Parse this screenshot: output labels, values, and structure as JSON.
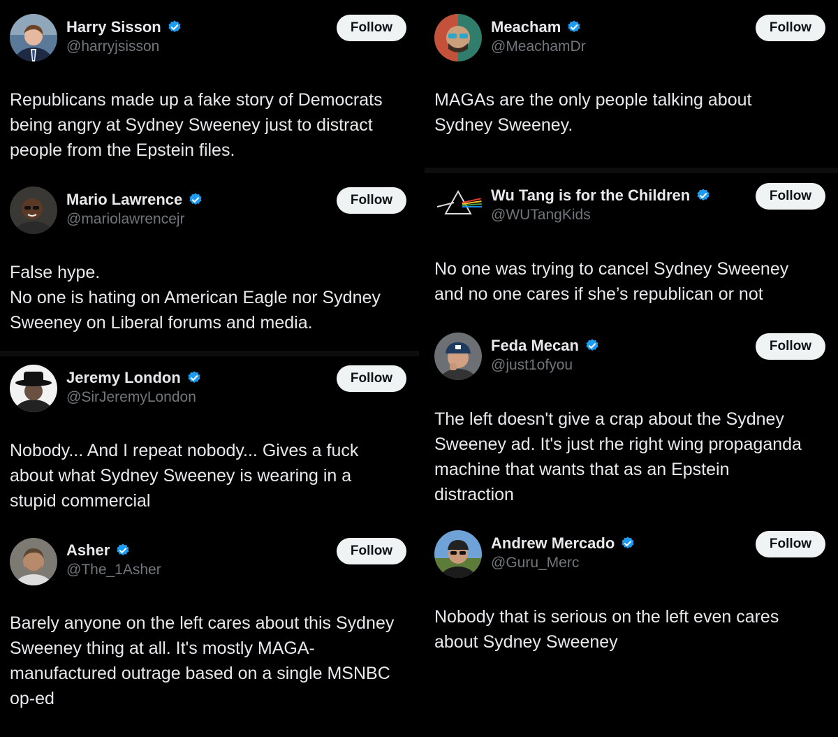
{
  "colors": {
    "background": "#000000",
    "text": "#e7e9ea",
    "handle": "#71767b",
    "verified_badge": "#1d9bf0",
    "follow_button_bg": "#eff3f4",
    "follow_button_text": "#0f1419"
  },
  "icons": {
    "verified": "verified-badge-icon"
  },
  "tweets": [
    {
      "name": "Harry Sisson",
      "handle": "@harryjsisson",
      "follow_label": "Follow",
      "text_lines": [
        "Republicans made up a fake story of Democrats",
        "being angry at Sydney Sweeney just to distract",
        "people from the Epstein files."
      ]
    },
    {
      "name": "Mario Lawrence",
      "handle": "@mariolawrencejr",
      "follow_label": "Follow",
      "text_lines": [
        "False hype.",
        "No one is hating on American Eagle nor Sydney",
        "Sweeney on Liberal forums and media."
      ]
    },
    {
      "name": "Jeremy London",
      "handle": "@SirJeremyLondon",
      "follow_label": "Follow",
      "text_lines": [
        "Nobody... And I repeat nobody... Gives a fuck",
        "about what Sydney Sweeney is wearing in a",
        "stupid commercial"
      ]
    },
    {
      "name": "Asher",
      "handle": "@The_1Asher",
      "follow_label": "Follow",
      "text_lines": [
        "Barely anyone on the left cares about this Sydney",
        "Sweeney thing at all. It's mostly MAGA-",
        "manufactured outrage based on a single MSNBC",
        "op-ed"
      ]
    },
    {
      "name": "Meacham",
      "handle": "@MeachamDr",
      "follow_label": "Follow",
      "text_lines": [
        "MAGAs are the only people talking about",
        "Sydney Sweeney."
      ]
    },
    {
      "name": "Wu Tang is for the Children",
      "handle": "@WUTangKids",
      "follow_label": "Follow",
      "text_lines": [
        "No one was trying to cancel Sydney Sweeney",
        "and no one cares if she’s republican or not"
      ]
    },
    {
      "name": "Feda Mecan",
      "handle": "@just1ofyou",
      "follow_label": "Follow",
      "text_lines": [
        "The left doesn't give a crap about the Sydney",
        "Sweeney ad. It's just rhe right wing propaganda",
        "machine that wants that as an Epstein",
        "distraction"
      ]
    },
    {
      "name": "Andrew Mercado",
      "handle": "@Guru_Merc",
      "follow_label": "Follow",
      "text_lines": [
        "Nobody that is serious on the left even cares",
        "about Sydney Sweeney"
      ]
    }
  ]
}
